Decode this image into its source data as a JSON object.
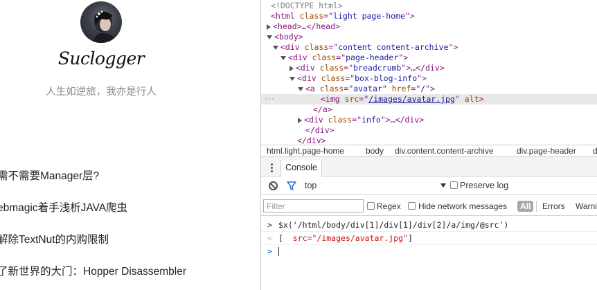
{
  "page": {
    "site_title": "Suclogger",
    "subtitle": "人生如逆旅，我亦是行人",
    "posts": [
      "需不需要Manager层?",
      "ebmagic着手浅析JAVA爬虫",
      "解除TextNut的内购限制",
      "了新世界的大门：Hopper Disassembler"
    ]
  },
  "devtools": {
    "elements": {
      "doctype": "<!DOCTYPE html>",
      "dots": "···",
      "lines": [
        {
          "open": "<html",
          "attrs": [
            {
              "n": "class",
              "v": "light page-home"
            }
          ],
          "close": ">"
        },
        {
          "open": "<head>",
          "attrs": [],
          "close": "…</head>"
        },
        {
          "open": "<body>",
          "attrs": [],
          "close": ""
        },
        {
          "open": "<div",
          "attrs": [
            {
              "n": "class",
              "v": "content content-archive"
            }
          ],
          "close": ">"
        },
        {
          "open": "<div",
          "attrs": [
            {
              "n": "class",
              "v": "page-header"
            }
          ],
          "close": ">"
        },
        {
          "open": "<div",
          "attrs": [
            {
              "n": "class",
              "v": "breadcrumb"
            }
          ],
          "close": ">…</div>"
        },
        {
          "open": "<div",
          "attrs": [
            {
              "n": "class",
              "v": "box-blog-info"
            }
          ],
          "close": ">"
        },
        {
          "open": "<a",
          "attrs": [
            {
              "n": "class",
              "v": "avatar"
            },
            {
              "n": "href",
              "v": "/"
            }
          ],
          "close": ">"
        },
        {
          "open": "<img",
          "attrs": [
            {
              "n": "src",
              "v": "/images/avatar.jpg"
            }
          ],
          "extra": "alt",
          "close": ">"
        },
        {
          "open": "</a>",
          "attrs": [],
          "close": ""
        },
        {
          "open": "<div",
          "attrs": [
            {
              "n": "class",
              "v": "info"
            }
          ],
          "close": ">…</div>"
        },
        {
          "open": "</div>",
          "attrs": [],
          "close": ""
        },
        {
          "open": "</div>",
          "attrs": [],
          "close": ""
        }
      ]
    },
    "breadcrumbs": [
      "html.light.page-home",
      "body",
      "div.content.content-archive",
      "div.page-header",
      "d"
    ],
    "drawer": {
      "tab_console": "Console"
    },
    "console_toolbar": {
      "context": "top",
      "preserve_log": "Preserve log"
    },
    "filter_bar": {
      "filter_placeholder": "Filter",
      "regex": "Regex",
      "hide_network": "Hide network messages",
      "all": "All",
      "errors": "Errors",
      "warnings": "Warni"
    },
    "console": {
      "input_prefix": ">",
      "output_prefix": "<",
      "prompt_prefix": ">",
      "command": "$x('/html/body/div[1]/div[1]/div[2]/a/img/@src')",
      "result_open": "[",
      "result_value": "src=\"/images/avatar.jpg\"",
      "result_close": "]"
    }
  }
}
